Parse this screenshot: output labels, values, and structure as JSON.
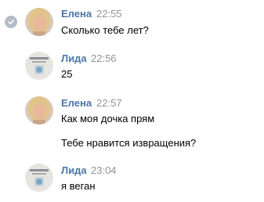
{
  "messages": [
    {
      "author": "Елена",
      "time": "22:55",
      "lines": [
        "Сколько тебе лет?"
      ],
      "avatar_icon": "avatar-blonde-woman",
      "read_check_icon": "check-icon"
    },
    {
      "author": "Лида",
      "time": "22:56",
      "lines": [
        "25"
      ],
      "avatar_icon": "avatar-poster-image"
    },
    {
      "author": "Елена",
      "time": "22:57",
      "lines": [
        "Как моя дочка прям",
        "Тебе нравится извращения?"
      ],
      "avatar_icon": "avatar-blonde-woman"
    },
    {
      "author": "Лида",
      "time": "23:04",
      "lines": [
        "я веган"
      ],
      "avatar_icon": "avatar-poster-image"
    }
  ],
  "colors": {
    "author_name": "#4a76a8",
    "time": "#939393",
    "text": "#000000",
    "check_badge": "#b3bcc7"
  }
}
